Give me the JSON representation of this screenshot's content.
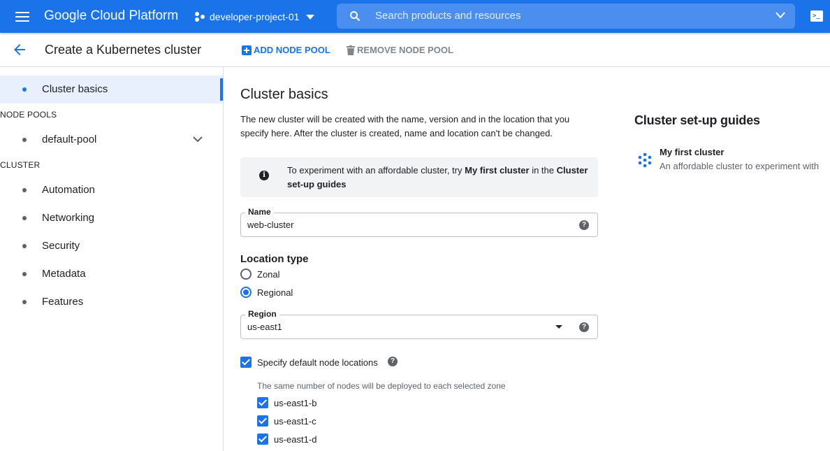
{
  "topbar": {
    "brand": "Google Cloud Platform",
    "project": "developer-project-01",
    "search_placeholder": "Search products and resources",
    "cloud_shell_glyph": ">_"
  },
  "subbar": {
    "title": "Create a Kubernetes cluster",
    "add_node_pool": "ADD NODE POOL",
    "remove_node_pool": "REMOVE NODE POOL"
  },
  "sidebar": {
    "active_item": "Cluster basics",
    "node_pools_header": "NODE POOLS",
    "node_pools": [
      "default-pool"
    ],
    "cluster_header": "CLUSTER",
    "cluster_items": [
      "Automation",
      "Networking",
      "Security",
      "Metadata",
      "Features"
    ]
  },
  "main": {
    "heading": "Cluster basics",
    "description": "The new cluster will be created with the name, version and in the location that you specify here. After the cluster is created, name and location can't be changed.",
    "info": {
      "prefix": "To experiment with an affordable cluster, try ",
      "link1": "My first cluster",
      "middle": " in the ",
      "link2": "Cluster set-up guides"
    },
    "name_label": "Name",
    "name_value": "web-cluster",
    "location_type_heading": "Location type",
    "location_options": [
      "Zonal",
      "Regional"
    ],
    "selected_location": "Regional",
    "region_label": "Region",
    "region_value": "us-east1",
    "specify_locations_label": "Specify default node locations",
    "specify_locations_checked": true,
    "zones_hint": "The same number of nodes will be deployed to each selected zone",
    "zones": [
      "us-east1-b",
      "us-east1-c",
      "us-east1-d"
    ]
  },
  "guides": {
    "heading": "Cluster set-up guides",
    "item_title": "My first cluster",
    "item_desc": "An affordable cluster to experiment with"
  },
  "colors": {
    "brand_blue": "#1a73e8",
    "text": "#202124",
    "muted": "#5f6368"
  }
}
